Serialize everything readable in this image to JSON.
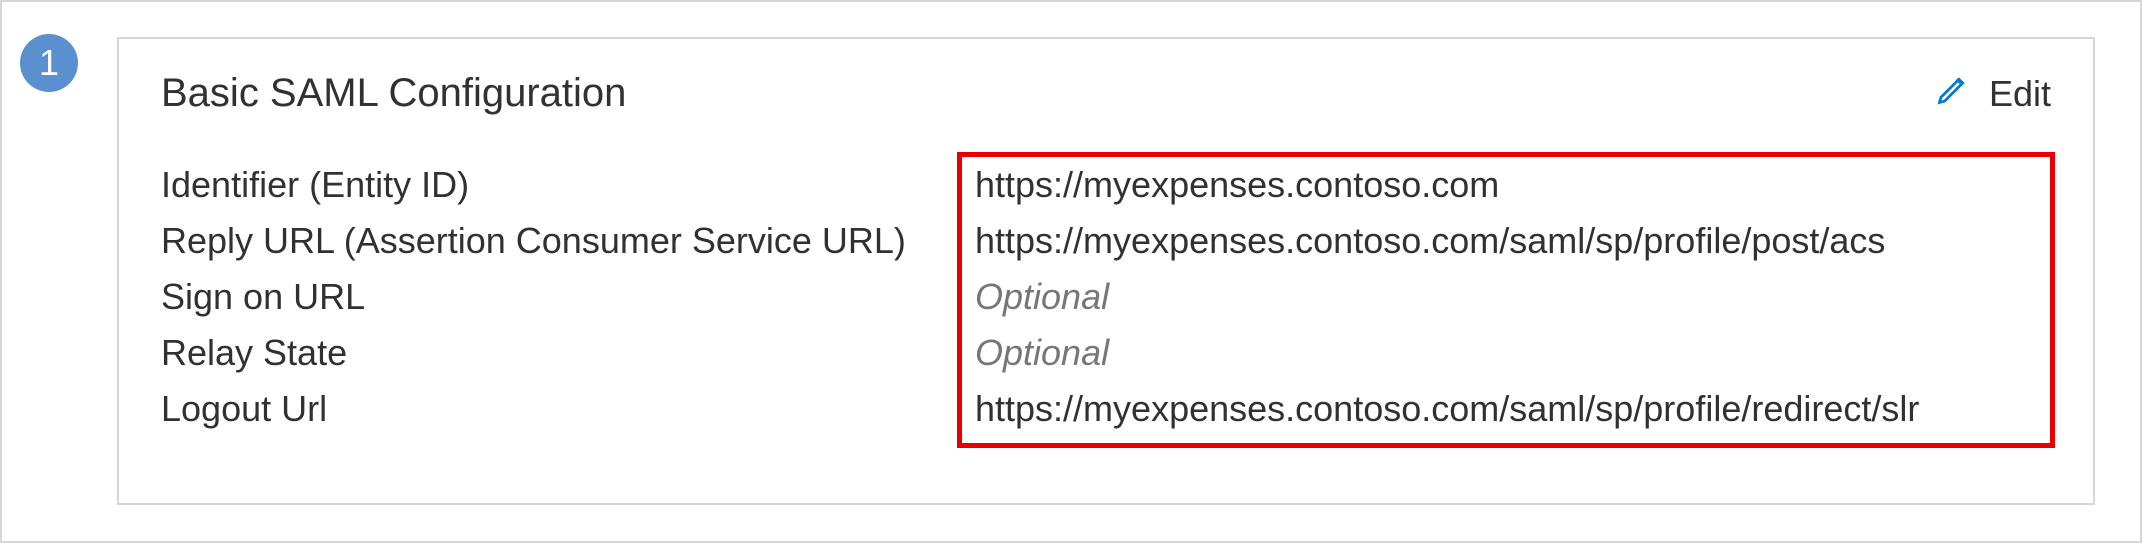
{
  "step": {
    "number": "1"
  },
  "card": {
    "title": "Basic SAML Configuration",
    "edit_label": "Edit"
  },
  "config": {
    "rows": [
      {
        "label": "Identifier (Entity ID)",
        "value": "https://myexpenses.contoso.com",
        "optional": false
      },
      {
        "label": "Reply URL (Assertion Consumer Service URL)",
        "value": "https://myexpenses.contoso.com/saml/sp/profile/post/acs",
        "optional": false
      },
      {
        "label": "Sign on URL",
        "value": "Optional",
        "optional": true
      },
      {
        "label": "Relay State",
        "value": "Optional",
        "optional": true
      },
      {
        "label": "Logout Url",
        "value": "https://myexpenses.contoso.com/saml/sp/profile/redirect/slr",
        "optional": false
      }
    ]
  }
}
